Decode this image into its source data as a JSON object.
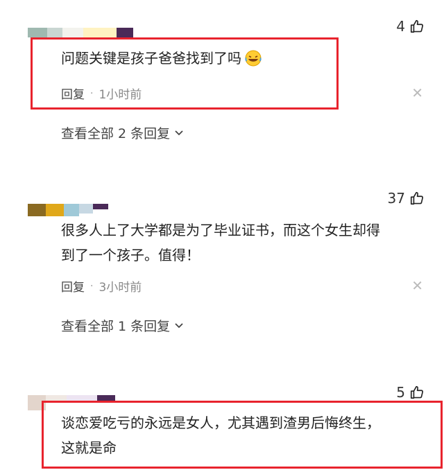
{
  "comments": [
    {
      "likes": "4",
      "text": "问题关键是孩子爸爸找到了吗",
      "reply_label": "回复",
      "time": "1小时前",
      "view_replies": "查看全部 2 条回复",
      "emoji": "laughing-crying-emoji"
    },
    {
      "likes": "37",
      "text_line1": "很多人上了大学都是为了毕业证书，而这个女生却得",
      "text_line2": "到了一个孩子。值得！",
      "reply_label": "回复",
      "time": "3小时前",
      "view_replies": "查看全部 1 条回复"
    },
    {
      "likes": "5",
      "text_line1": "谈恋爱吃亏的永远是女人，尤其遇到渣男后悔终生，",
      "text_line2": "这就是命"
    }
  ],
  "colors": {
    "highlight_box": "#e8232d"
  }
}
